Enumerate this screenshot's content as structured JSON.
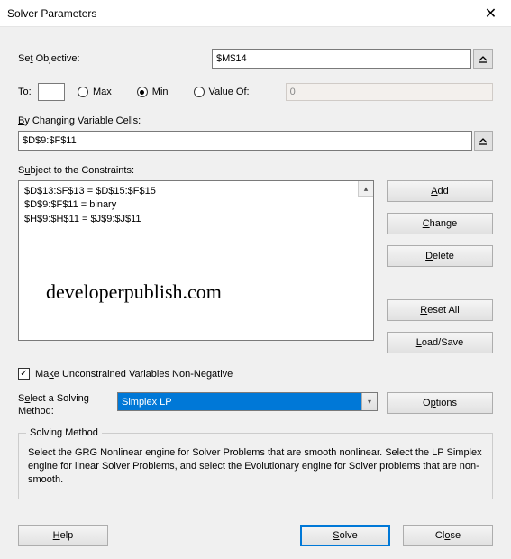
{
  "window": {
    "title": "Solver Parameters"
  },
  "objective": {
    "label_pre": "Se",
    "label_u": "t",
    "label_post": " Objective:",
    "value": "$M$14"
  },
  "to": {
    "label_u": "T",
    "label_post": "o:",
    "max_u": "M",
    "max_post": "ax",
    "min_pre": "Mi",
    "min_u": "n",
    "valof_u": "V",
    "valof_post": "alue Of:",
    "value_of": "0"
  },
  "changing": {
    "label_u": "B",
    "label_post": "y Changing Variable Cells:",
    "value": "$D$9:$F$11"
  },
  "constraints": {
    "label_pre": "S",
    "label_u": "u",
    "label_post": "bject to the Constraints:",
    "lines": [
      "$D$13:$F$13 = $D$15:$F$15",
      "$D$9:$F$11 = binary",
      "$H$9:$H$11 = $J$9:$J$11"
    ],
    "watermark": "developerpublish.com"
  },
  "buttons": {
    "add_u": "A",
    "add_post": "dd",
    "change_u": "C",
    "change_post": "hange",
    "delete_u": "D",
    "delete_post": "elete",
    "reset_u": "R",
    "reset_post": "eset All",
    "load_u": "L",
    "load_post": "oad/Save",
    "options_pre": "O",
    "options_u": "p",
    "options_post": "tions",
    "help_u": "H",
    "help_post": "elp",
    "solve_u": "S",
    "solve_post": "olve",
    "close_pre": "Cl",
    "close_u": "o",
    "close_post": "se"
  },
  "checkbox": {
    "pre": "Ma",
    "u": "k",
    "post": "e Unconstrained Variables Non-Negative",
    "checked": "✓"
  },
  "method": {
    "label_pre": "S",
    "label_u": "e",
    "label_mid": "lect a Solving Method:",
    "selected": "Simplex LP"
  },
  "groupbox": {
    "title": "Solving Method",
    "text": "Select the GRG Nonlinear engine for Solver Problems that are smooth nonlinear. Select the LP Simplex engine for linear Solver Problems, and select the Evolutionary engine for Solver problems that are non-smooth."
  }
}
